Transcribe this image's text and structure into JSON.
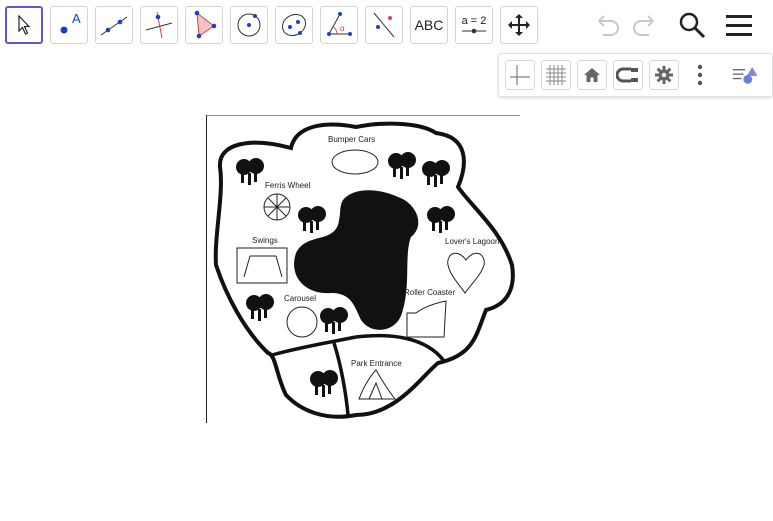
{
  "toolbar": {
    "tools": [
      {
        "name": "move",
        "icon": "arrow-pointer-icon"
      },
      {
        "name": "point",
        "icon": "point-icon",
        "glyph": "A"
      },
      {
        "name": "line",
        "icon": "line-icon"
      },
      {
        "name": "perpendicular",
        "icon": "perpendicular-line-icon"
      },
      {
        "name": "polygon",
        "icon": "polygon-icon"
      },
      {
        "name": "circle",
        "icon": "circle-with-center-icon"
      },
      {
        "name": "conic",
        "icon": "ellipse-icon"
      },
      {
        "name": "angle",
        "icon": "angle-icon",
        "glyph": "α"
      },
      {
        "name": "reflect",
        "icon": "reflect-icon"
      },
      {
        "name": "text",
        "icon": "text-icon",
        "label": "ABC"
      },
      {
        "name": "slider",
        "icon": "slider-icon",
        "label": "a = 2"
      },
      {
        "name": "move-graphics",
        "icon": "move-graphics-icon"
      }
    ],
    "undo_icon": "undo-icon",
    "redo_icon": "redo-icon",
    "search_icon": "search-icon",
    "menu_icon": "hamburger-menu-icon"
  },
  "stylebar": {
    "buttons": [
      "axes-icon",
      "grid-icon",
      "home-icon",
      "point-capturing-icon",
      "settings-gear-icon",
      "more-vertical-icon",
      "toggle-style-bar-icon"
    ]
  },
  "map": {
    "labels": {
      "bumper_cars": "Bumper Cars",
      "ferris_wheel": "Ferris Wheel",
      "swings": "Swings",
      "lovers_lagoon": "Lover's Lagoon",
      "roller_coaster": "Roller Coaster",
      "carousel": "Carousel",
      "park_entrance": "Park Entrance"
    }
  },
  "colors": {
    "active_tool_border": "#6557d2",
    "point_blue": "#1d3fc4",
    "accent_red": "#d9424f",
    "disabled_gray": "#c8c8c8"
  }
}
